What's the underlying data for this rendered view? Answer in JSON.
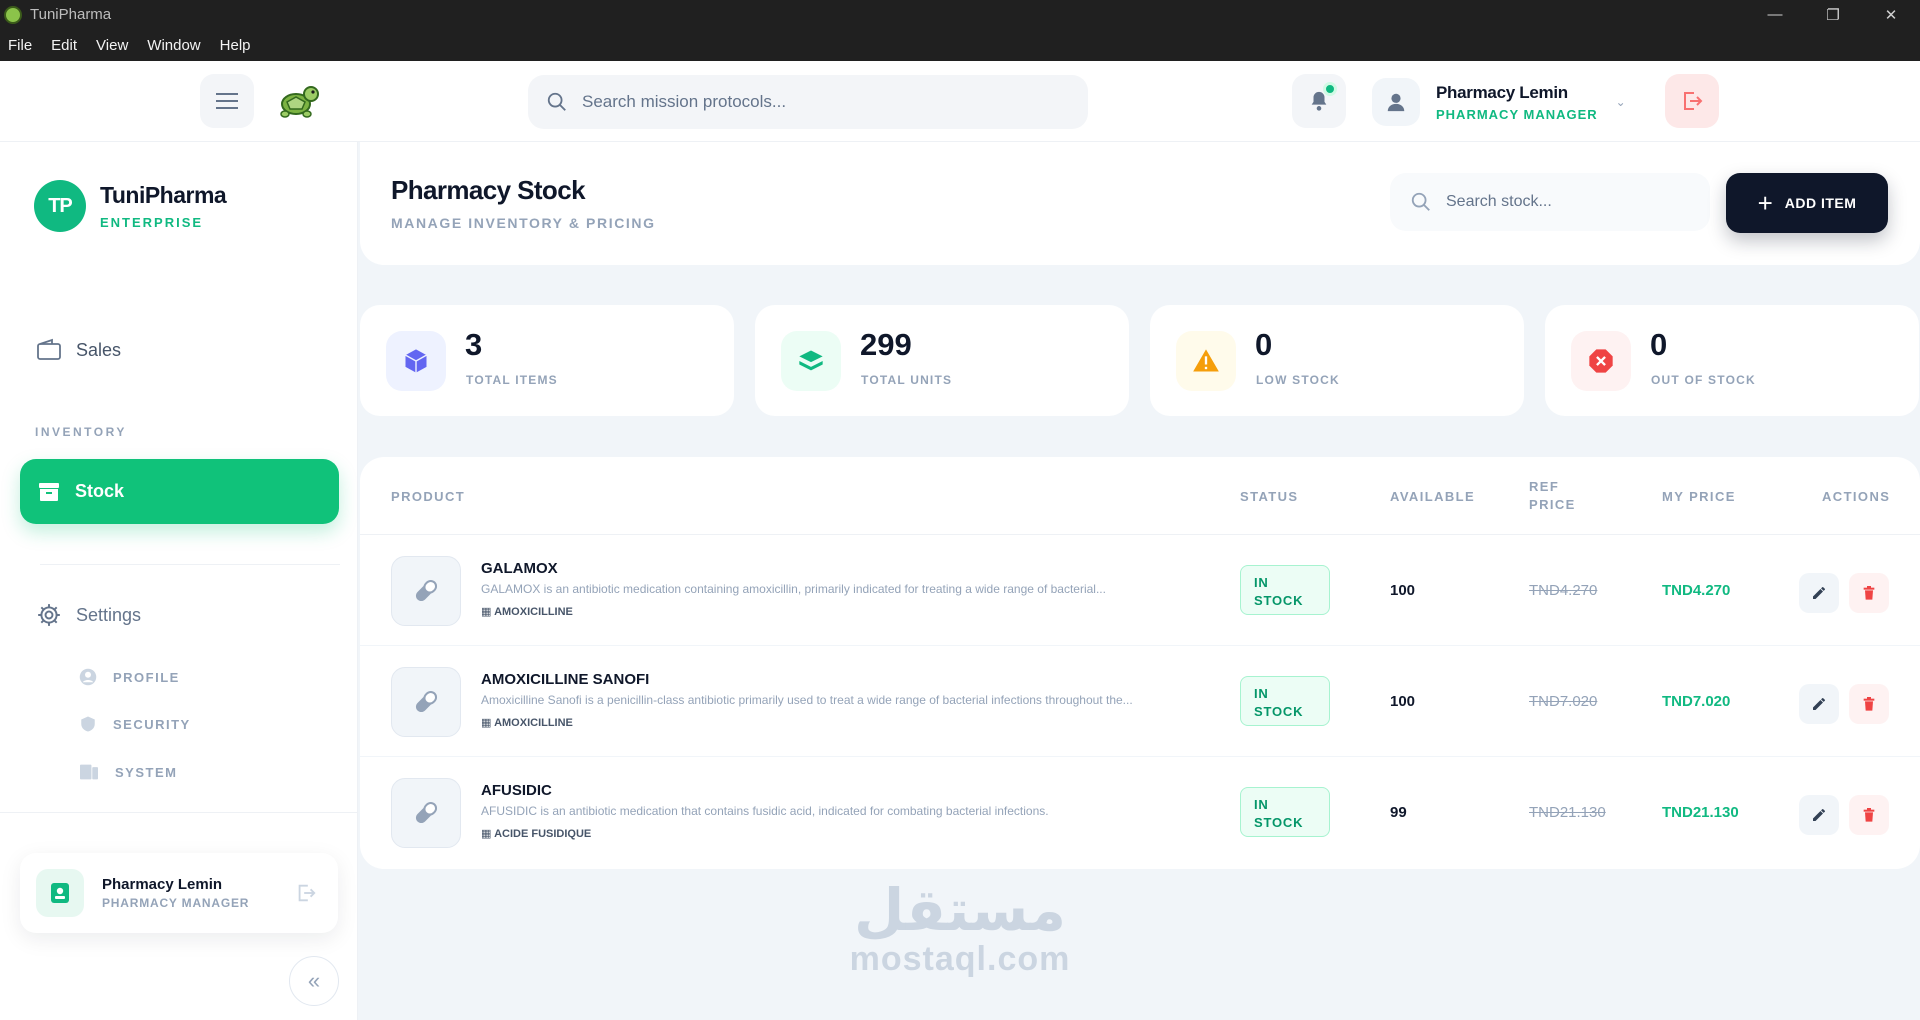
{
  "window": {
    "title": "TuniPharma",
    "menu": [
      "File",
      "Edit",
      "View",
      "Window",
      "Help"
    ]
  },
  "topbar": {
    "search_placeholder": "Search mission protocols...",
    "user_name": "Pharmacy Lemin",
    "user_role": "PHARMACY MANAGER"
  },
  "sidebar": {
    "brand_initials": "TP",
    "brand_name": "TuniPharma",
    "brand_sub": "ENTERPRISE",
    "sales_label": "Sales",
    "section_inventory": "INVENTORY",
    "stock_label": "Stock",
    "settings_label": "Settings",
    "settings_items": [
      "PROFILE",
      "SECURITY",
      "SYSTEM"
    ],
    "profile_name": "Pharmacy Lemin",
    "profile_role": "PHARMACY MANAGER"
  },
  "page": {
    "title": "Pharmacy Stock",
    "subtitle": "MANAGE INVENTORY & PRICING",
    "search_placeholder": "Search stock...",
    "add_label": "ADD ITEM"
  },
  "stats": [
    {
      "value": "3",
      "label": "TOTAL ITEMS",
      "color": "#6366f1"
    },
    {
      "value": "299",
      "label": "TOTAL UNITS",
      "color": "#10b981"
    },
    {
      "value": "0",
      "label": "LOW STOCK",
      "color": "#f59e0b"
    },
    {
      "value": "0",
      "label": "OUT OF STOCK",
      "color": "#ef4444"
    }
  ],
  "table": {
    "headers": {
      "product": "PRODUCT",
      "status": "STATUS",
      "available": "AVAILABLE",
      "ref_price_1": "REF",
      "ref_price_2": "PRICE",
      "my_price": "MY PRICE",
      "actions": "ACTIONS"
    },
    "rows": [
      {
        "name": "GALAMOX",
        "description": "GALAMOX is an antibiotic medication containing amoxicillin, primarily indicated for treating a wide range of bacterial...",
        "generic": "AMOXICILLINE",
        "status_1": "IN",
        "status_2": "STOCK",
        "available": "100",
        "ref_price": "TND4.270",
        "my_price": "TND4.270"
      },
      {
        "name": "AMOXICILLINE SANOFI",
        "description": "Amoxicilline Sanofi is a penicillin-class antibiotic primarily used to treat a wide range of bacterial infections throughout the...",
        "generic": "AMOXICILLINE",
        "status_1": "IN",
        "status_2": "STOCK",
        "available": "100",
        "ref_price": "TND7.020",
        "my_price": "TND7.020"
      },
      {
        "name": "AFUSIDIC",
        "description": "AFUSIDIC is an antibiotic medication that contains fusidic acid, indicated for combating bacterial infections.",
        "generic": "ACIDE FUSIDIQUE",
        "status_1": "IN",
        "status_2": "STOCK",
        "available": "99",
        "ref_price": "TND21.130",
        "my_price": "TND21.130"
      }
    ]
  },
  "watermark": {
    "arabic": "مستقل",
    "latin": "mostaql.com"
  }
}
